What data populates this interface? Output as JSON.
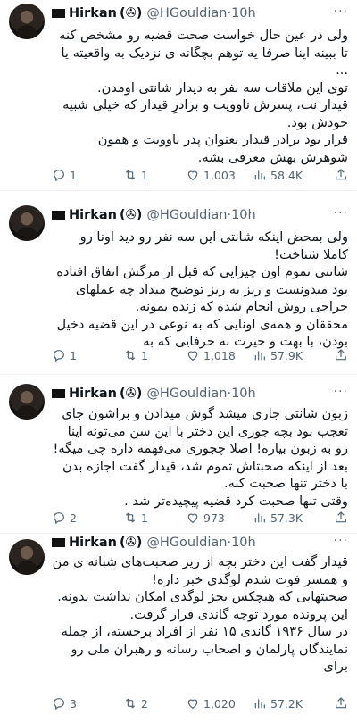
{
  "tweets": [
    {
      "display_name": "Hirkan",
      "name_suffix": "(✇)",
      "handle": "@HGouldian",
      "time": "10h",
      "more": "···",
      "paragraphs": [
        "ولی در عین حال خواست صحت قضیه رو مشخص کنه تا ببینه اینا صرفا یه توهم بچگانه ی نزدیک به واقعیته یا ...",
        "توی این ملاقات سه نفر به دیدار شانتی اومدن.",
        "قیدار نت، پسرش ناوویت و برادرِ قیدار که خیلی شبیه خودش بود.",
        "قرار بود برادر قیدار بعنوان پدر ناوویت و همون شوهرش بهش معرفی بشه."
      ],
      "replies": "1",
      "retweets": "1",
      "likes": "1,003",
      "views": "58.4K"
    },
    {
      "display_name": "Hirkan",
      "name_suffix": "(✇)",
      "handle": "@HGouldian",
      "time": "10h",
      "more": "···",
      "paragraphs": [
        "ولی بمحض اینکه شانتی این سه نفر رو دید اونا رو کاملا شناخت!",
        "شانتی تموم اون چیزایی که قبل از مرگش اتفاق افتاده بود میدونست و ریز به ریز توضیح میداد چه عملهای جراحی روش انجام شده که زنده بمونه.",
        "محققان و همه‌ی اونایی که به نوعی در این قضیه دخیل بودن، با بهت و حیرت به حرفایی که به"
      ],
      "replies": "1",
      "retweets": "1",
      "likes": "1,018",
      "views": "57.9K"
    },
    {
      "display_name": "Hirkan",
      "name_suffix": "(✇)",
      "handle": "@HGouldian",
      "time": "10h",
      "more": "···",
      "paragraphs": [
        "زبون شانتی جاری میشد گوش میدادن و براشون جای تعجب بود بچه جوری این دختر با این سن می‌تونه اینا رو به زبون بیاره! اصلا چجوری می‌فهمه داره چی میگه!",
        "بعد از اینکه صحبتاش تموم شد، قیدار گفت اجازه بدن با دختر تنها صحبت کنه.",
        "وقتی تنها صحبت کرد قضیه پیچیده‌تر شد ."
      ],
      "replies": "2",
      "retweets": "1",
      "likes": "973",
      "views": "57.3K"
    },
    {
      "display_name": "Hirkan",
      "name_suffix": "(✇)",
      "handle": "@HGouldian",
      "time": "10h",
      "more": "···",
      "paragraphs": [
        "قیدار گفت این دختر بچه از ریز صحبت‌های شبانه ی من و همسر فوت شدم لوگدی خبر داره!",
        "صحبتهایی که هیچکس بجز لوگدی امکان نداشت بدونه.",
        "این پرونده مورد توجه گاندی قرار گرفت.",
        "در سال ۱۹۳۶ گاندی ۱۵ نفر از افراد برجسته، از جمله نمایندگان پارلمان و اصحاب رسانه و رهبران ملی رو برای"
      ],
      "replies": "3",
      "retweets": "2",
      "likes": "1,020",
      "views": "57.2K"
    }
  ],
  "colors": {
    "text": "#0f1419",
    "muted": "#536471",
    "divider": "#eff3f4"
  }
}
